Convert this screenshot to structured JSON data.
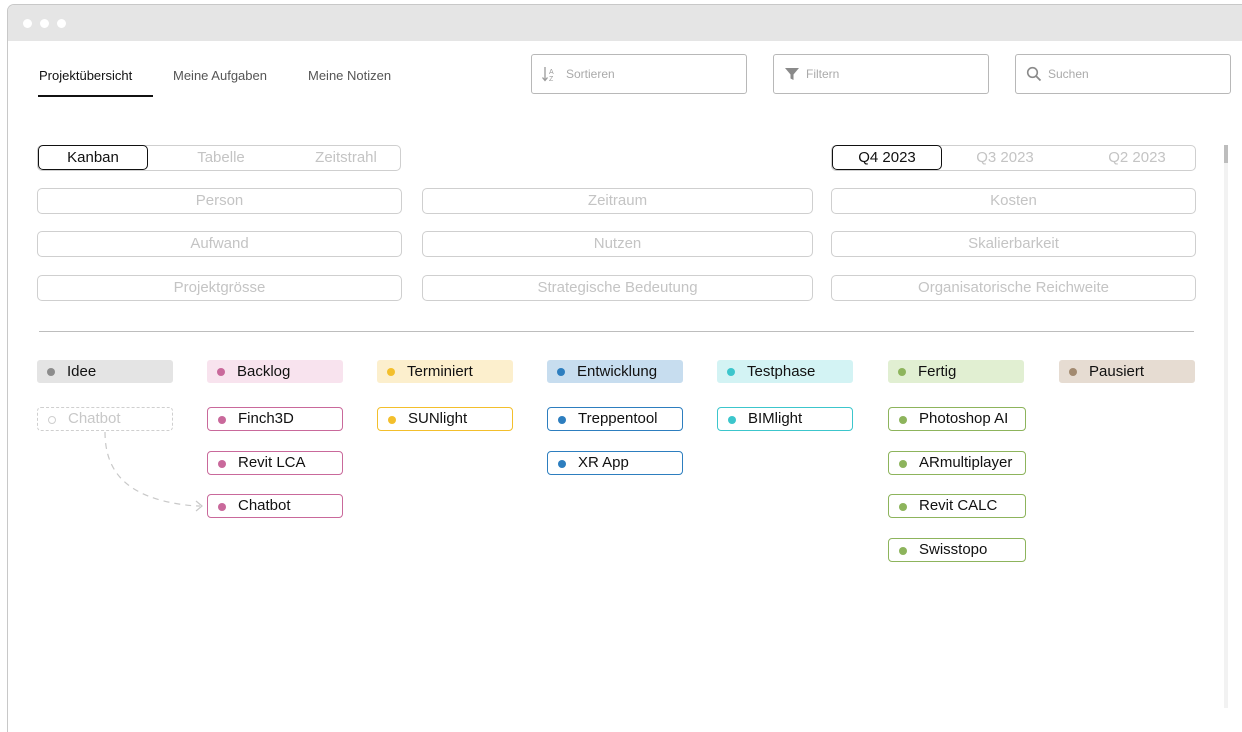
{
  "nav": {
    "tabs": [
      {
        "label": "Projektübersicht",
        "active": true
      },
      {
        "label": "Meine Aufgaben",
        "active": false
      },
      {
        "label": "Meine Notizen",
        "active": false
      }
    ]
  },
  "toolbar": {
    "sort_label": "Sortieren",
    "filter_label": "Filtern",
    "search_placeholder": "Suchen"
  },
  "views": {
    "items": [
      "Kanban",
      "Tabelle",
      "Zeitstrahl"
    ],
    "active": "Kanban"
  },
  "quarters": {
    "items": [
      "Q4 2023",
      "Q3 2023",
      "Q2 2023"
    ],
    "active": "Q4 2023"
  },
  "filters": [
    "Person",
    "Zeitraum",
    "Kosten",
    "Aufwand",
    "Nutzen",
    "Skalierbarkeit",
    "Projektgrösse",
    "Strategische Bedeutung",
    "Organisatorische Reichweite"
  ],
  "columns": [
    {
      "label": "Idee",
      "color": "#8c8c8c",
      "bg": "#e4e4e4",
      "cards": [],
      "ghost_card": "Chatbot"
    },
    {
      "label": "Backlog",
      "color": "#c9699b",
      "bg": "#f8e3ee",
      "cards": [
        "Finch3D",
        "Revit LCA",
        "Chatbot"
      ]
    },
    {
      "label": "Terminiert",
      "color": "#f3bf2c",
      "bg": "#fcefcd",
      "cards": [
        "SUNlight"
      ]
    },
    {
      "label": "Entwicklung",
      "color": "#2d7ebf",
      "bg": "#c7ddef",
      "cards": [
        "Treppentool",
        "XR App"
      ]
    },
    {
      "label": "Testphase",
      "color": "#3cc6cc",
      "bg": "#d3f3f4",
      "cards": [
        "BIMlight"
      ]
    },
    {
      "label": "Fertig",
      "color": "#8db45c",
      "bg": "#e1efd2",
      "cards": [
        "Photoshop AI",
        "ARmultiplayer",
        "Revit CALC",
        "Swisstopo"
      ]
    },
    {
      "label": "Pausiert",
      "color": "#a28a70",
      "bg": "#e6dcd2",
      "cards": []
    }
  ],
  "icons": {
    "sort": "sort-icon",
    "filter": "funnel-icon",
    "search": "search-icon"
  }
}
